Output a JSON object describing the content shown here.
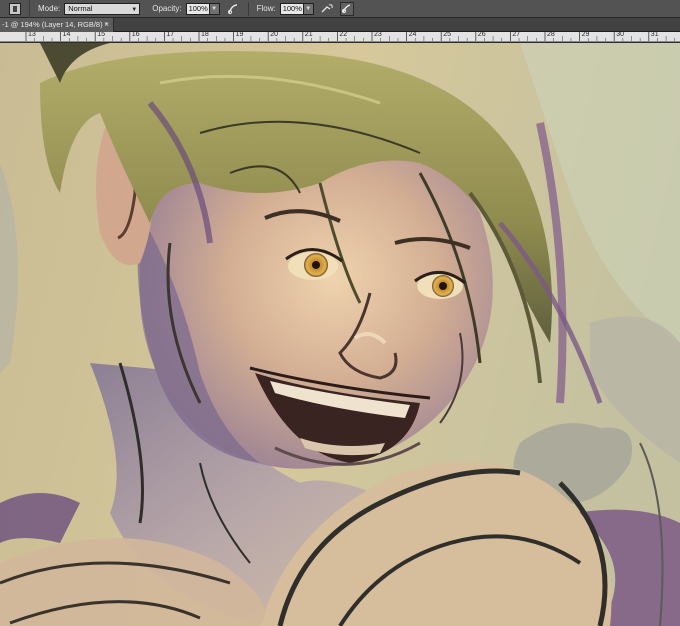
{
  "options_bar": {
    "mode_label": "Mode:",
    "mode_value": "Normal",
    "opacity_label": "Opacity:",
    "opacity_value": "100%",
    "flow_label": "Flow:",
    "flow_value": "100%",
    "icons": [
      "tool-preset-icon",
      "pressure-opacity-icon",
      "airbrush-icon",
      "pressure-size-icon"
    ]
  },
  "document_tab": {
    "title": "-1 @ 194% (Layer 14, RGB/8) *",
    "close_glyph": "×"
  },
  "ruler": {
    "labels": [
      "13",
      "14",
      "15",
      "16",
      "17",
      "18",
      "19",
      "20",
      "21",
      "22",
      "23",
      "24",
      "25",
      "26",
      "27",
      "28",
      "29",
      "30",
      "31"
    ]
  },
  "canvas": {
    "content": "digital painting",
    "colors": {
      "background": "#cdbf97",
      "skin": "#d8b79c",
      "hair": "#8c8a4a",
      "shadow_purple": "#7a5f86",
      "line_dark": "#2f2e2a",
      "eye": "#d6a23a"
    }
  }
}
